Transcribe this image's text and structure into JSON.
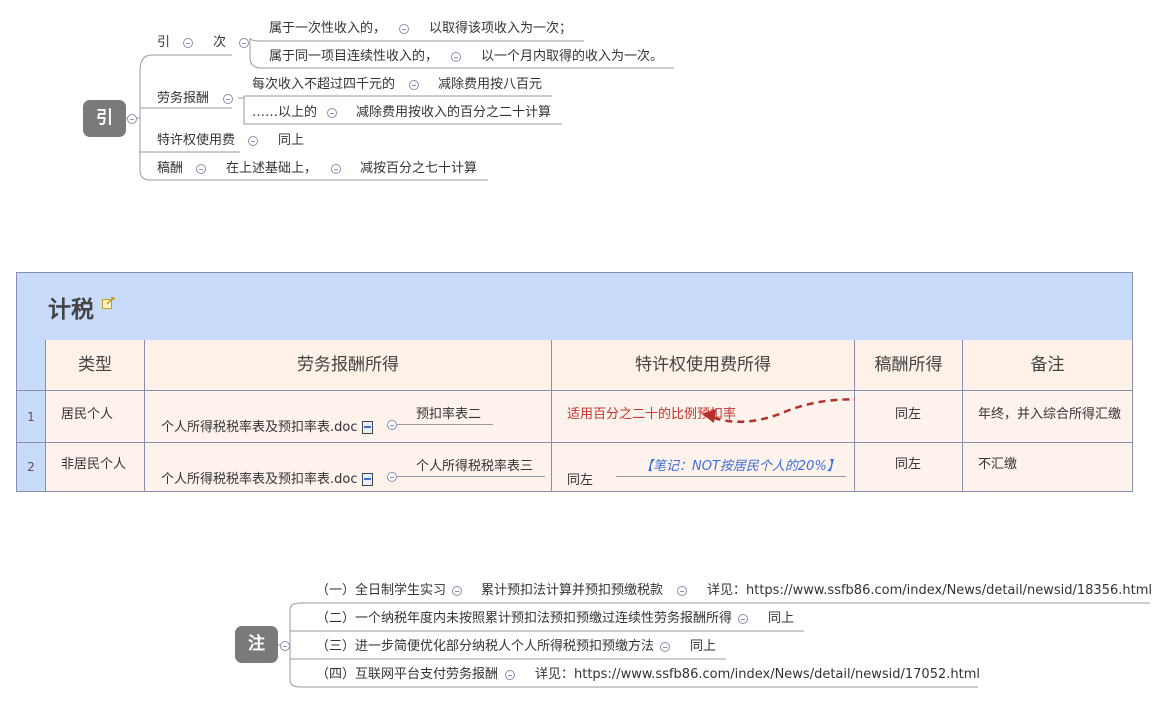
{
  "map1": {
    "root": "引",
    "yin": {
      "label": "引",
      "sub": "次",
      "items": [
        {
          "label": "属于一次性收入的，",
          "value": "以取得该项收入为一次；"
        },
        {
          "label": "属于同一项目连续性收入的，",
          "value": "以一个月内取得的收入为一次。"
        }
      ]
    },
    "labor": {
      "label": "劳务报酬",
      "items": [
        {
          "label": "每次收入不超过四千元的",
          "value": "减除费用按八百元"
        },
        {
          "label": "……以上的",
          "value": "减除费用按收入的百分之二十计算"
        }
      ]
    },
    "royalty": {
      "label": "特许权使用费",
      "value": "同上"
    },
    "manuscript": {
      "label": "稿酬",
      "mid": "在上述基础上，",
      "value": "减按百分之七十计算"
    }
  },
  "table": {
    "title": "计税",
    "headers": [
      "类型",
      "劳务报酬所得",
      "特许权使用费所得",
      "稿酬所得",
      "备注"
    ],
    "rows": [
      {
        "index": "1",
        "type": "居民个人",
        "labor_file": "个人所得税税率表及预扣率表.doc",
        "labor_value": "预扣率表二",
        "royalty": "适用百分之二十的比例预扣率",
        "manuscript": "同左",
        "remark": "年终，并入综合所得汇缴"
      },
      {
        "index": "2",
        "type": "非居民个人",
        "labor_file": "个人所得税税率表及预扣率表.doc",
        "labor_value": "个人所得税税率表三",
        "royalty": "同左",
        "royalty_note": "【笔记：NOT按居民个人的20%】",
        "manuscript": "同左",
        "remark": "不汇缴"
      }
    ],
    "colors": {
      "header_bg": "#c9dbfb",
      "cell_bg": "#fdf1e8",
      "border": "#8a8fb0",
      "red": "#c8322f",
      "note": "#3f6ed8"
    }
  },
  "map2": {
    "root": "注",
    "items": [
      {
        "label": "（一）全日制学生实习",
        "mid": "累计预扣法计算并预扣预缴税款",
        "value": "详见：https://www.ssfb86.com/index/News/detail/newsid/18356.html"
      },
      {
        "label": "（二）一个纳税年度内未按照累计预扣法预扣预缴过连续性劳务报酬所得",
        "value": "同上"
      },
      {
        "label": "（三）进一步简便优化部分纳税人个人所得税预扣预缴方法",
        "value": "同上"
      },
      {
        "label": "（四）互联网平台支付劳务报酬",
        "value": "详见：https://www.ssfb86.com/index/News/detail/newsid/17052.html"
      }
    ]
  }
}
